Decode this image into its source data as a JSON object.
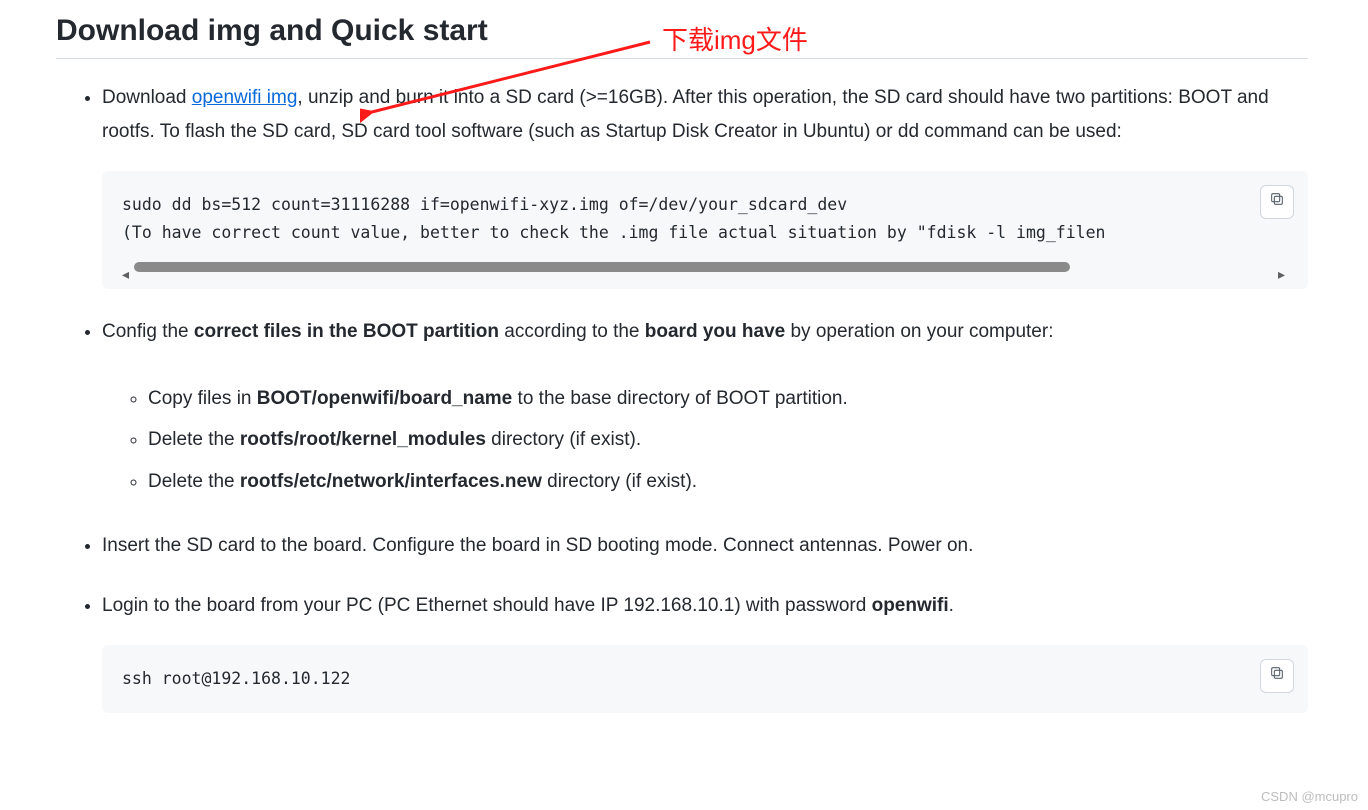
{
  "heading": "Download img and Quick start",
  "annotation": "下载img文件",
  "bullet1": {
    "pre": "Download ",
    "link": "openwifi img",
    "post": ", unzip and burn it into a SD card (>=16GB). After this operation, the SD card should have two partitions: BOOT and rootfs. To flash the SD card, SD card tool software (such as Startup Disk Creator in Ubuntu) or dd command can be used:"
  },
  "code1_line1": "sudo dd bs=512 count=31116288 if=openwifi-xyz.img of=/dev/your_sdcard_dev",
  "code1_line2": "(To have correct count value, better to check the .img file actual situation by \"fdisk -l img_filen",
  "bullet2": {
    "pre": "Config the ",
    "b1": "correct files in the BOOT partition",
    "mid": " according to the ",
    "b2": "board you have",
    "post": " by operation on your computer:"
  },
  "sub1": {
    "pre": "Copy files in ",
    "b": "BOOT/openwifi/board_name",
    "post": " to the base directory of BOOT partition."
  },
  "sub2": {
    "pre": "Delete the ",
    "b": "rootfs/root/kernel_modules",
    "post": " directory (if exist)."
  },
  "sub3": {
    "pre": "Delete the ",
    "b": "rootfs/etc/network/interfaces.new",
    "post": " directory (if exist)."
  },
  "bullet3": "Insert the SD card to the board. Configure the board in SD booting mode. Connect antennas. Power on.",
  "bullet4": {
    "pre": "Login to the board from your PC (PC Ethernet should have IP 192.168.10.1) with password ",
    "b": "openwifi",
    "post": "."
  },
  "code2": "ssh root@192.168.10.122",
  "watermark": "CSDN @mcupro"
}
